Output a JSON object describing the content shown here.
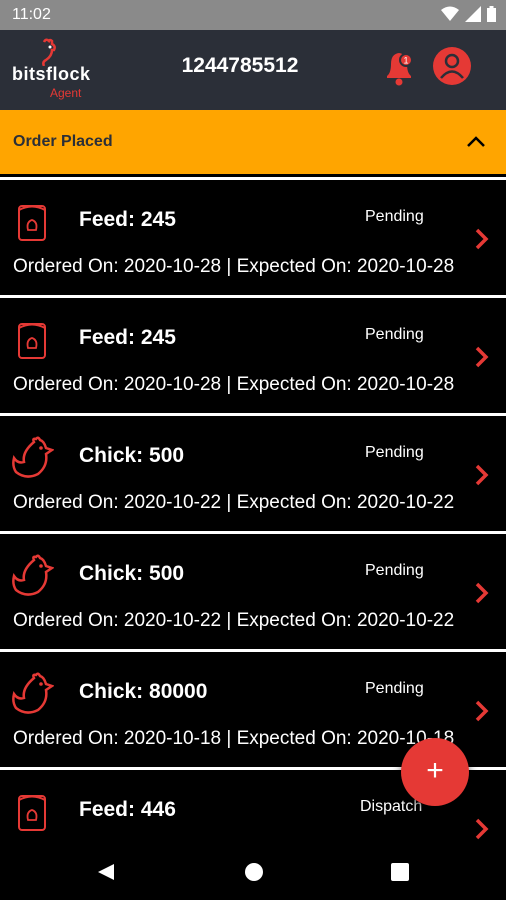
{
  "status_bar": {
    "time": "11:02"
  },
  "app_bar": {
    "logo_text": "bitsflock",
    "logo_subtext": "Agent",
    "phone_number": "1244785512"
  },
  "section": {
    "title": "Order Placed"
  },
  "orders": [
    {
      "icon": "feed-bag-icon",
      "title": "Feed: 245",
      "status": "Pending",
      "dates": "Ordered On: 2020-10-28 | Expected On: 2020-10-28"
    },
    {
      "icon": "feed-bag-icon",
      "title": "Feed: 245",
      "status": "Pending",
      "dates": "Ordered On: 2020-10-28 | Expected On: 2020-10-28"
    },
    {
      "icon": "chick-icon",
      "title": "Chick: 500",
      "status": "Pending",
      "dates": "Ordered On: 2020-10-22 | Expected On: 2020-10-22"
    },
    {
      "icon": "chick-icon",
      "title": "Chick: 500",
      "status": "Pending",
      "dates": "Ordered On: 2020-10-22 | Expected On: 2020-10-22"
    },
    {
      "icon": "chick-icon",
      "title": "Chick: 80000",
      "status": "Pending",
      "dates": "Ordered On: 2020-10-18 | Expected On: 2020-10-18"
    },
    {
      "icon": "feed-bag-icon",
      "title": "Feed: 446",
      "status": "Dispatch",
      "dates": ""
    }
  ],
  "fab": {
    "label": "+"
  },
  "colors": {
    "accent": "#e53935",
    "section": "#ffa500",
    "app_bar": "#2b2f38",
    "background": "#000000"
  }
}
